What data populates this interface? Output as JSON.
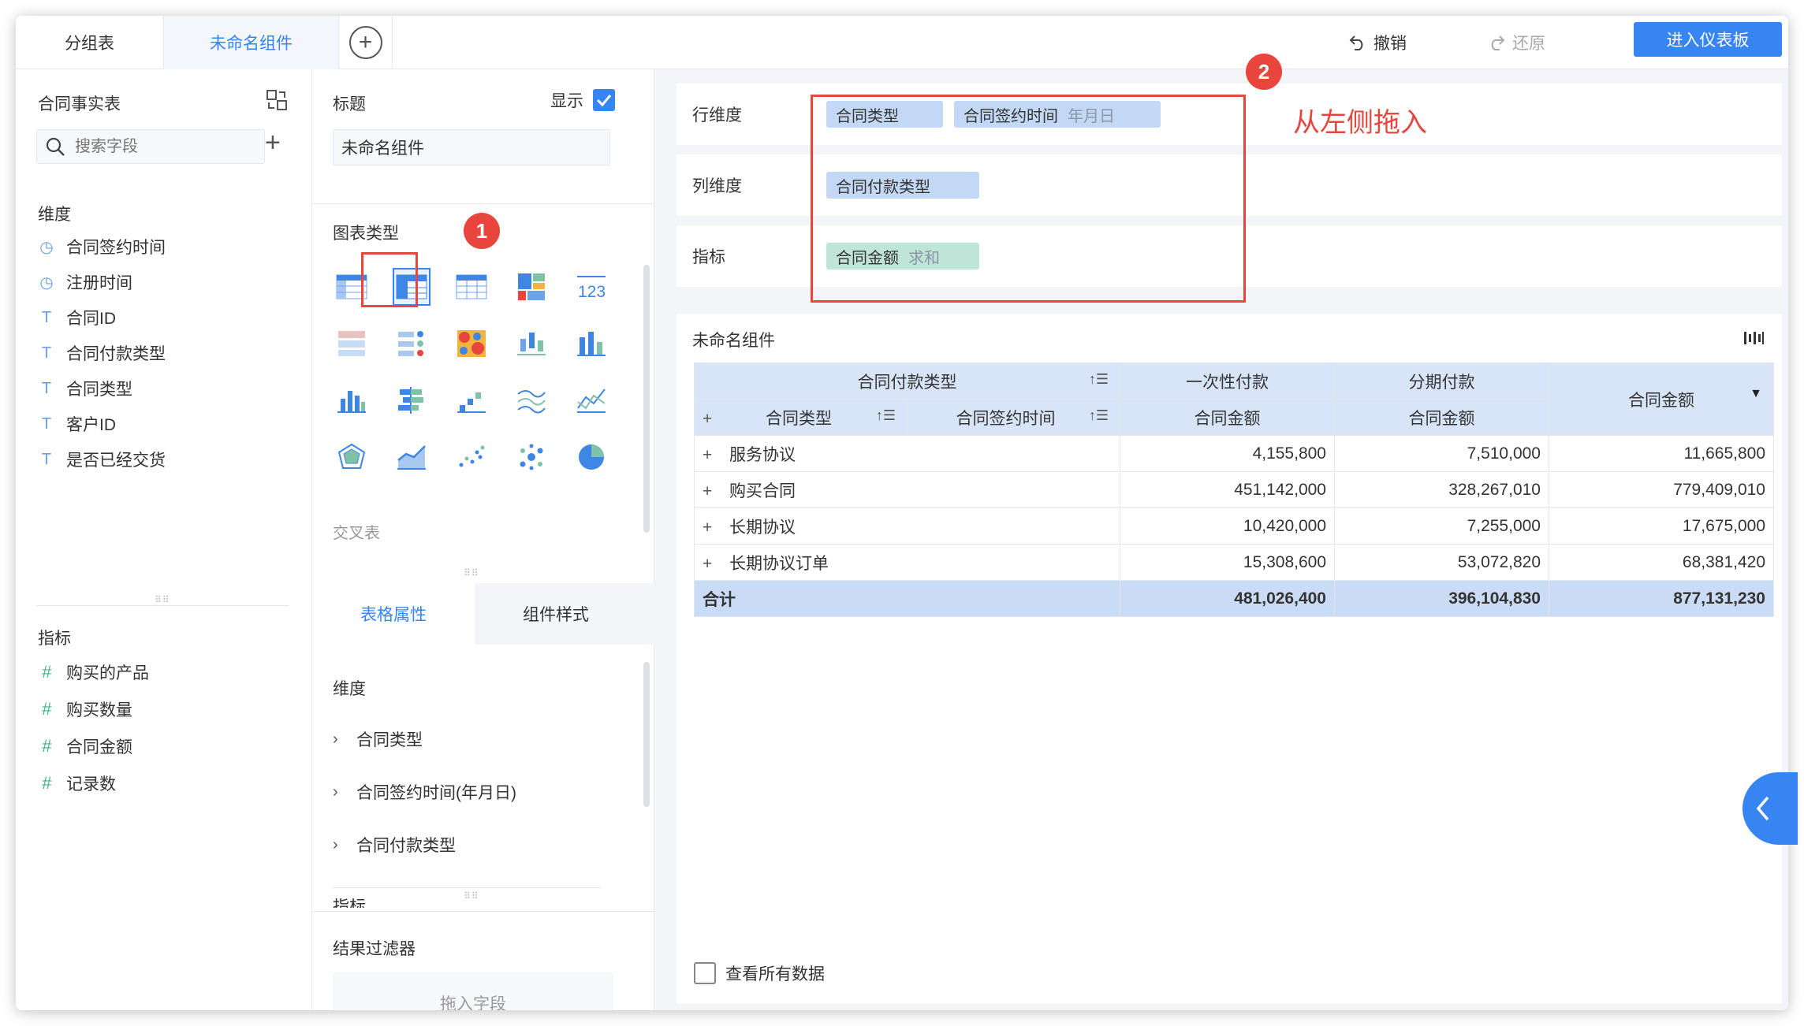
{
  "tabs": [
    {
      "label": "分组表"
    },
    {
      "label": "未命名组件"
    }
  ],
  "toolbar": {
    "undo": "撤销",
    "redo": "还原",
    "enter_dashboard": "进入仪表板"
  },
  "left_panel": {
    "table_name": "合同事实表",
    "search_placeholder": "搜索字段",
    "dimension_label": "维度",
    "dimensions": [
      {
        "label": "合同签约时间",
        "icon": "clock-icon"
      },
      {
        "label": "注册时间",
        "icon": "clock-icon"
      },
      {
        "label": "合同ID",
        "icon": "text-type-icon"
      },
      {
        "label": "合同付款类型",
        "icon": "text-type-icon"
      },
      {
        "label": "合同类型",
        "icon": "text-type-icon"
      },
      {
        "label": "客户ID",
        "icon": "text-type-icon"
      },
      {
        "label": "是否已经交货",
        "icon": "text-type-icon"
      }
    ],
    "measure_label": "指标",
    "measures": [
      {
        "label": "购买的产品",
        "icon": "number-icon"
      },
      {
        "label": "购买数量",
        "icon": "number-icon"
      },
      {
        "label": "合同金额",
        "icon": "number-icon"
      },
      {
        "label": "记录数",
        "icon": "number-icon"
      }
    ]
  },
  "middle_panel": {
    "title_label": "标题",
    "show_label": "显示",
    "title_value": "未命名组件",
    "chart_type_label": "图表类型",
    "selected_chart_name": "交叉表",
    "badge1": "1",
    "prop_tab_active": "表格属性",
    "prop_tab_other": "组件样式",
    "dimension_label": "维度",
    "tree_items": [
      "合同类型",
      "合同签约时间(年月日)",
      "合同付款类型"
    ],
    "measure_partial": "指标",
    "filter_label": "结果过滤器",
    "drop_placeholder": "拖入字段"
  },
  "shelves": {
    "row_label": "行维度",
    "row_pills": [
      {
        "label": "合同类型",
        "sub": ""
      },
      {
        "label": "合同签约时间",
        "sub": "年月日"
      }
    ],
    "col_label": "列维度",
    "col_pills": [
      {
        "label": "合同付款类型",
        "sub": ""
      }
    ],
    "measure_label": "指标",
    "measure_pills": [
      {
        "label": "合同金额",
        "sub": "求和"
      }
    ],
    "badge2": "2",
    "hint": "从左侧拖入"
  },
  "widget": {
    "title": "未命名组件",
    "header": {
      "col_dim": "合同付款类型",
      "col_values": [
        "一次性付款",
        "分期付款"
      ],
      "total_measure": "合同金额",
      "row_dim1": "合同类型",
      "row_dim2": "合同签约时间",
      "measure": "合同金额"
    },
    "rows": [
      {
        "label": "服务协议",
        "v1": "4,155,800",
        "v2": "7,510,000",
        "total": "11,665,800"
      },
      {
        "label": "购买合同",
        "v1": "451,142,000",
        "v2": "328,267,010",
        "total": "779,409,010"
      },
      {
        "label": "长期协议",
        "v1": "10,420,000",
        "v2": "7,255,000",
        "total": "17,675,000"
      },
      {
        "label": "长期协议订单",
        "v1": "15,308,600",
        "v2": "53,072,820",
        "total": "68,381,420"
      }
    ],
    "total_row": {
      "label": "合计",
      "v1": "481,026,400",
      "v2": "396,104,830",
      "total": "877,131,230"
    },
    "view_all": "查看所有数据"
  },
  "colors": {
    "accent": "#3685f2",
    "annotation_red": "#e8453c",
    "dimension_pill": "#c3d8f4",
    "measure_pill": "#bfe4d8"
  }
}
